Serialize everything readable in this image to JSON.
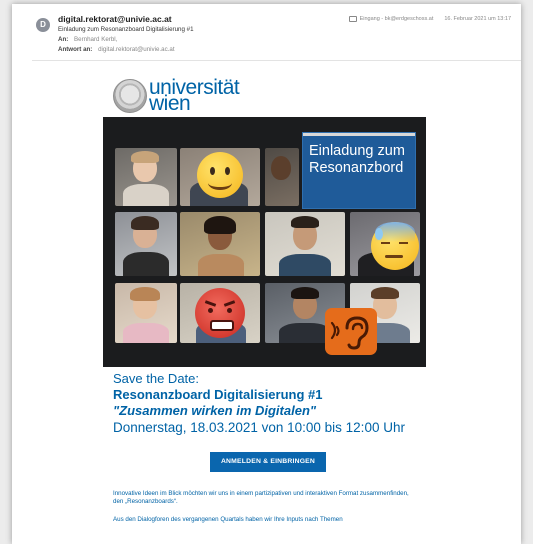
{
  "header": {
    "avatar_initial": "D",
    "from": "digital.rektorat@univie.ac.at",
    "subject": "Einladung zum Resonanzboard Digitalisierung #1",
    "to_label": "An:",
    "to_value": "Bernhard Kerbl,",
    "reply_label": "Antwort an:",
    "reply_value": "digital.rektorat@univie.ac.at",
    "mailbox": "Eingang - bk@erdgeschoss.at",
    "date": "16. Februar 2021 um 13:17"
  },
  "logo": {
    "line1": "universität",
    "line2": "wien"
  },
  "hero": {
    "banner_text": "Einladung zum Resonanzbord",
    "emojis": [
      "smiling-face-emoji",
      "sweating-face-emoji",
      "angry-face-emoji"
    ],
    "badge_icon": "ear-sound-icon",
    "colors": {
      "banner": "#1f5b99",
      "badge": "#e56c1b",
      "background": "#1b1c1e"
    }
  },
  "event": {
    "save_the_date": "Save the Date:",
    "title": "Resonanzboard Digitalisierung #1",
    "subtitle": "\"Zusammen wirken im Digitalen\"",
    "datetime": "Donnerstag, 18.03.2021 von 10:00 bis 12:00 Uhr"
  },
  "cta": {
    "label": "ANMELDEN & EINBRINGEN"
  },
  "body": {
    "paragraph1": "Innovative Ideen im Blick möchten wir uns in einem partizipativen und interaktiven Format zusammenfinden, den „Resonanzboards“.",
    "paragraph2": "Aus den Dialogforen des vergangenen Quartals haben wir Ihre Inputs nach Themen"
  },
  "colors": {
    "brand_blue": "#0063a6",
    "button": "#0a66ae"
  }
}
